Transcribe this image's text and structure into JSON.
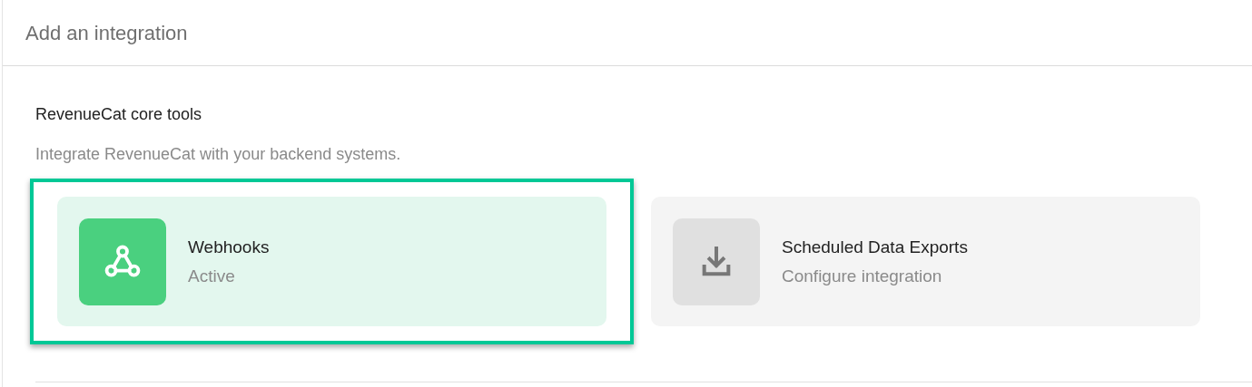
{
  "header": {
    "title": "Add an integration"
  },
  "section": {
    "title": "RevenueCat core tools",
    "description": "Integrate RevenueCat with your backend systems."
  },
  "cards": [
    {
      "kind": "webhook",
      "name": "Webhooks",
      "status": "Active",
      "active": true,
      "highlighted": true
    },
    {
      "kind": "download",
      "name": "Scheduled Data Exports",
      "status": "Configure integration",
      "active": false,
      "highlighted": false
    }
  ]
}
